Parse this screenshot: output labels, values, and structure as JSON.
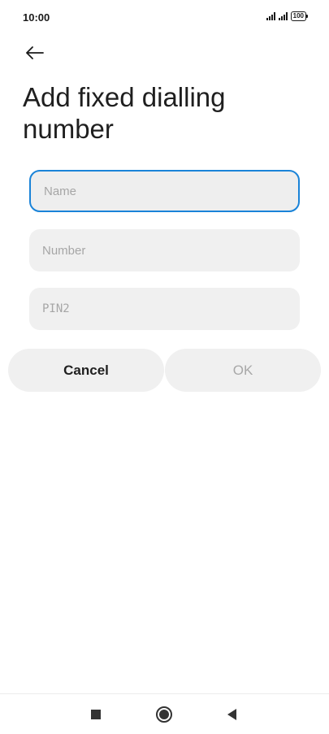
{
  "status_bar": {
    "time": "10:00",
    "battery": "100"
  },
  "header": {
    "title": "Add fixed dialling number"
  },
  "form": {
    "name_placeholder": "Name",
    "number_placeholder": "Number",
    "pin_placeholder": "PIN2"
  },
  "actions": {
    "cancel_label": "Cancel",
    "ok_label": "OK"
  },
  "colors": {
    "accent": "#1a83d8",
    "field_bg": "#f0f0f0",
    "disabled_text": "#a8a8a8"
  },
  "icons": {
    "back": "arrow-left-icon",
    "recents": "square-icon",
    "home": "circle-icon",
    "nav_back": "triangle-left-icon"
  }
}
